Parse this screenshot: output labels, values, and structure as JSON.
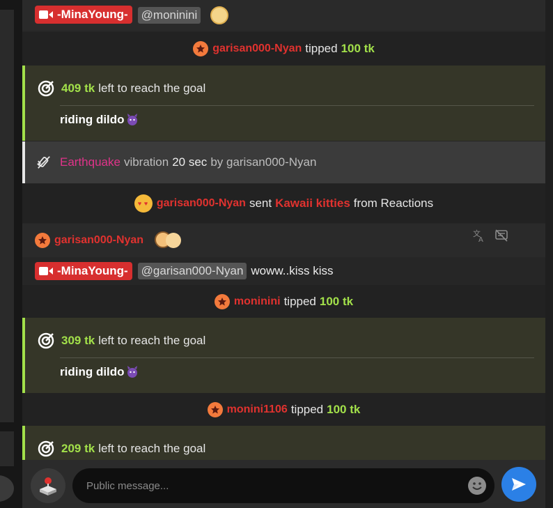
{
  "top_message": {
    "sender": "-MinaYoung-",
    "mention": "@moninini"
  },
  "tip1": {
    "user": "garisan000-Nyan",
    "verb": "tipped",
    "amount": "100 tk"
  },
  "goal1": {
    "remaining": "409 tk",
    "text": "left to reach the goal",
    "goal_name": "riding dildo"
  },
  "vibration": {
    "pattern": "Earthquake",
    "word": "vibration",
    "duration": "20 sec",
    "by": "by garisan000-Nyan"
  },
  "reaction": {
    "user": "garisan000-Nyan",
    "verb": "sent",
    "item": "Kawaii kitties",
    "suffix": "from Reactions"
  },
  "user_message": {
    "user": "garisan000-Nyan"
  },
  "reply": {
    "sender": "-MinaYoung-",
    "mention": "@garisan000-Nyan",
    "text": "woww..kiss kiss"
  },
  "tip2": {
    "user": "moninini",
    "verb": "tipped",
    "amount": "100 tk"
  },
  "goal2": {
    "remaining": "309 tk",
    "text": "left to reach the goal",
    "goal_name": "riding dildo"
  },
  "tip3": {
    "user": "monini1106",
    "verb": "tipped",
    "amount": "100 tk"
  },
  "goal3": {
    "remaining": "209 tk",
    "text": "left to reach the goal"
  },
  "composer": {
    "placeholder": "Public message..."
  },
  "colors": {
    "accent_green": "#a2e04a",
    "user_red": "#e0322f",
    "pink": "#e0338a",
    "send_blue": "#2b80e6"
  }
}
